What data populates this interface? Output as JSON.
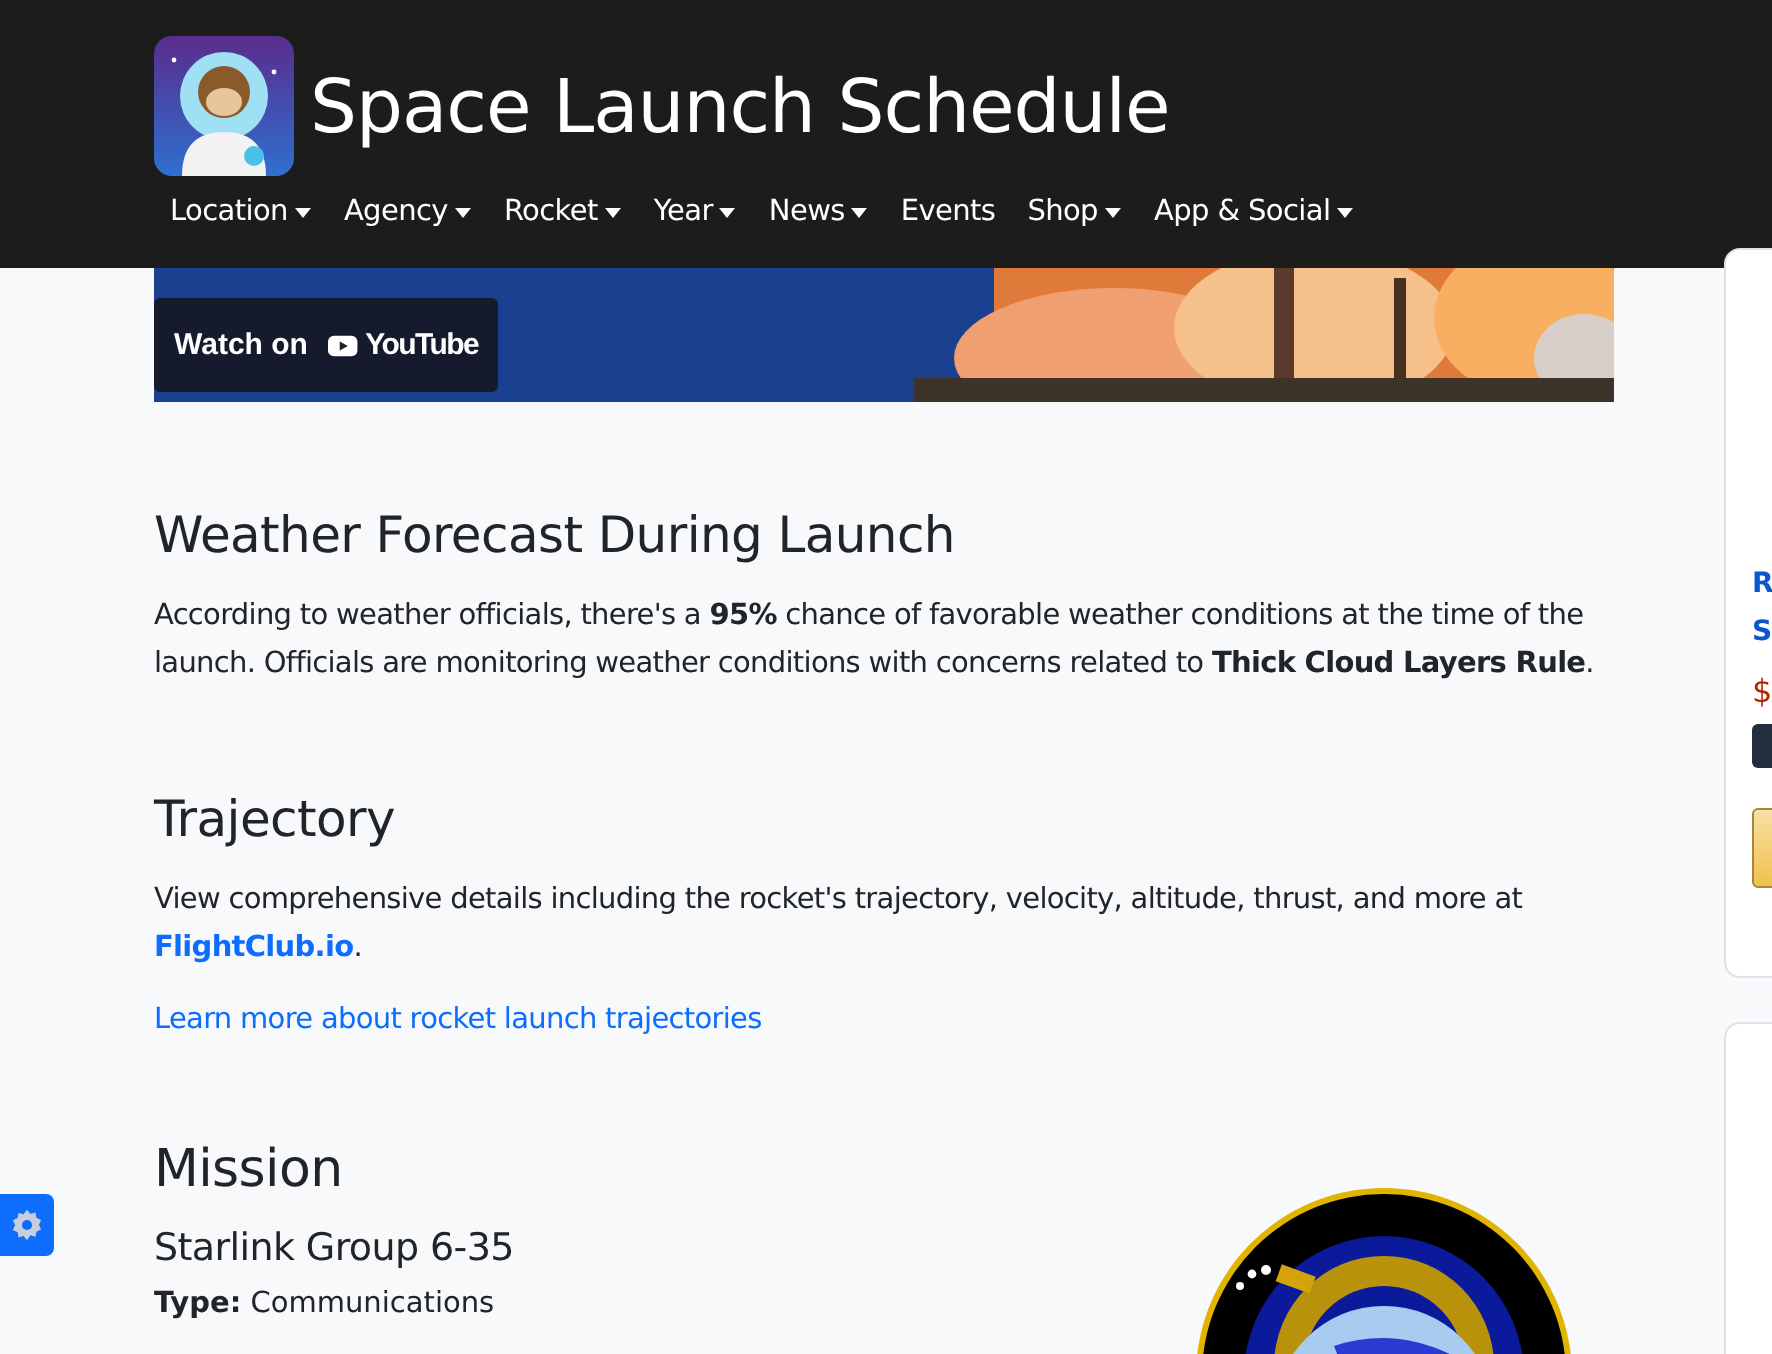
{
  "header": {
    "title": "Space Launch Schedule"
  },
  "nav": [
    {
      "label": "Location",
      "dropdown": true
    },
    {
      "label": "Agency",
      "dropdown": true
    },
    {
      "label": "Rocket",
      "dropdown": true
    },
    {
      "label": "Year",
      "dropdown": true
    },
    {
      "label": "News",
      "dropdown": true
    },
    {
      "label": "Events",
      "dropdown": false
    },
    {
      "label": "Shop",
      "dropdown": true
    },
    {
      "label": "App & Social",
      "dropdown": true
    }
  ],
  "video": {
    "watch_label": "Watch on",
    "logo_text": "YouTube"
  },
  "weather": {
    "heading": "Weather Forecast During Launch",
    "text": "According to weather officials, there's a **95%** chance of favorable weather conditions at the time of the launch. Officials are monitoring weather conditions with concerns related to **Thick Cloud Layers Rule**."
  },
  "trajectory": {
    "heading": "Trajectory",
    "text": "View comprehensive details including the rocket's trajectory, velocity, altitude, thrust, and more at",
    "link": "FlightClub.io",
    "after_link": ".",
    "more_link": "Learn more about rocket launch trajectories"
  },
  "mission": {
    "heading": "Mission",
    "name": "Starlink Group 6-35",
    "type_label": "Type:",
    "type_value": "Communications"
  },
  "sidebar": {
    "link_lines": [
      "R",
      "S"
    ],
    "price": "$"
  }
}
